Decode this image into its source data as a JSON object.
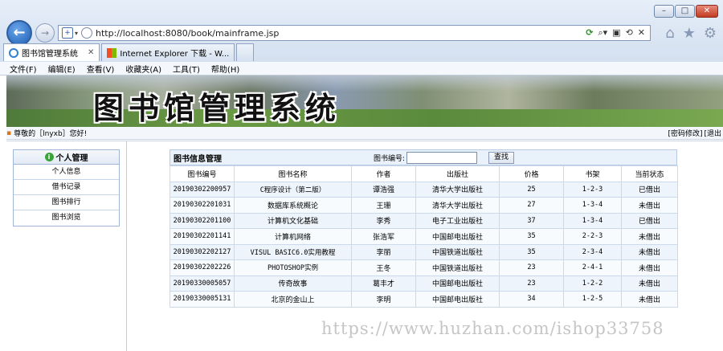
{
  "browser": {
    "url": "http://localhost:8080/book/mainframe.jsp",
    "tabs": [
      {
        "label": "图书馆管理系统",
        "active": true
      },
      {
        "label": "Internet Explorer 下载 - W...",
        "active": false
      }
    ],
    "menu": [
      "文件(F)",
      "编辑(E)",
      "查看(V)",
      "收藏夹(A)",
      "工具(T)",
      "帮助(H)"
    ]
  },
  "banner": {
    "title": "图书馆管理系统"
  },
  "welcome": {
    "text": "尊敬的［lnyxb］您好!",
    "links": [
      "[密码修改]",
      "[退出"
    ]
  },
  "sidebar": {
    "heading": "个人管理",
    "items": [
      "个人信息",
      "借书记录",
      "图书排行",
      "图书浏览"
    ]
  },
  "panel": {
    "title": "图书信息管理",
    "search_label": "图书编号:",
    "search_value": "",
    "search_button": "查找"
  },
  "table": {
    "headers": [
      "图书编号",
      "图书名称",
      "作者",
      "出版社",
      "价格",
      "书架",
      "当前状态"
    ],
    "rows": [
      [
        "20190302200957",
        "C程序设计（第二版）",
        "谭浩强",
        "清华大学出版社",
        "25",
        "1-2-3",
        "已借出"
      ],
      [
        "20190302201031",
        "数据库系统概论",
        "王珊",
        "清华大学出版社",
        "27",
        "1-3-4",
        "未借出"
      ],
      [
        "20190302201100",
        "计算机文化基础",
        "李秀",
        "电子工业出版社",
        "37",
        "1-3-4",
        "已借出"
      ],
      [
        "20190302201141",
        "计算机网络",
        "张浩军",
        "中国邮电出版社",
        "35",
        "2-2-3",
        "未借出"
      ],
      [
        "20190302202127",
        "VISUL BASIC6.0实用教程",
        "李丽",
        "中国铁道出版社",
        "35",
        "2-3-4",
        "未借出"
      ],
      [
        "20190302202226",
        "PHOTOSHOP实例",
        "王冬",
        "中国铁道出版社",
        "23",
        "2-4-1",
        "未借出"
      ],
      [
        "20190330005057",
        "传奇故事",
        "葛丰才",
        "中国邮电出版社",
        "23",
        "1-2-2",
        "未借出"
      ],
      [
        "20190330005131",
        "北京的金山上",
        "李明",
        "中国邮电出版社",
        "34",
        "1-2-5",
        "未借出"
      ]
    ]
  },
  "watermark": "https://www.huzhan.com/ishop33758"
}
